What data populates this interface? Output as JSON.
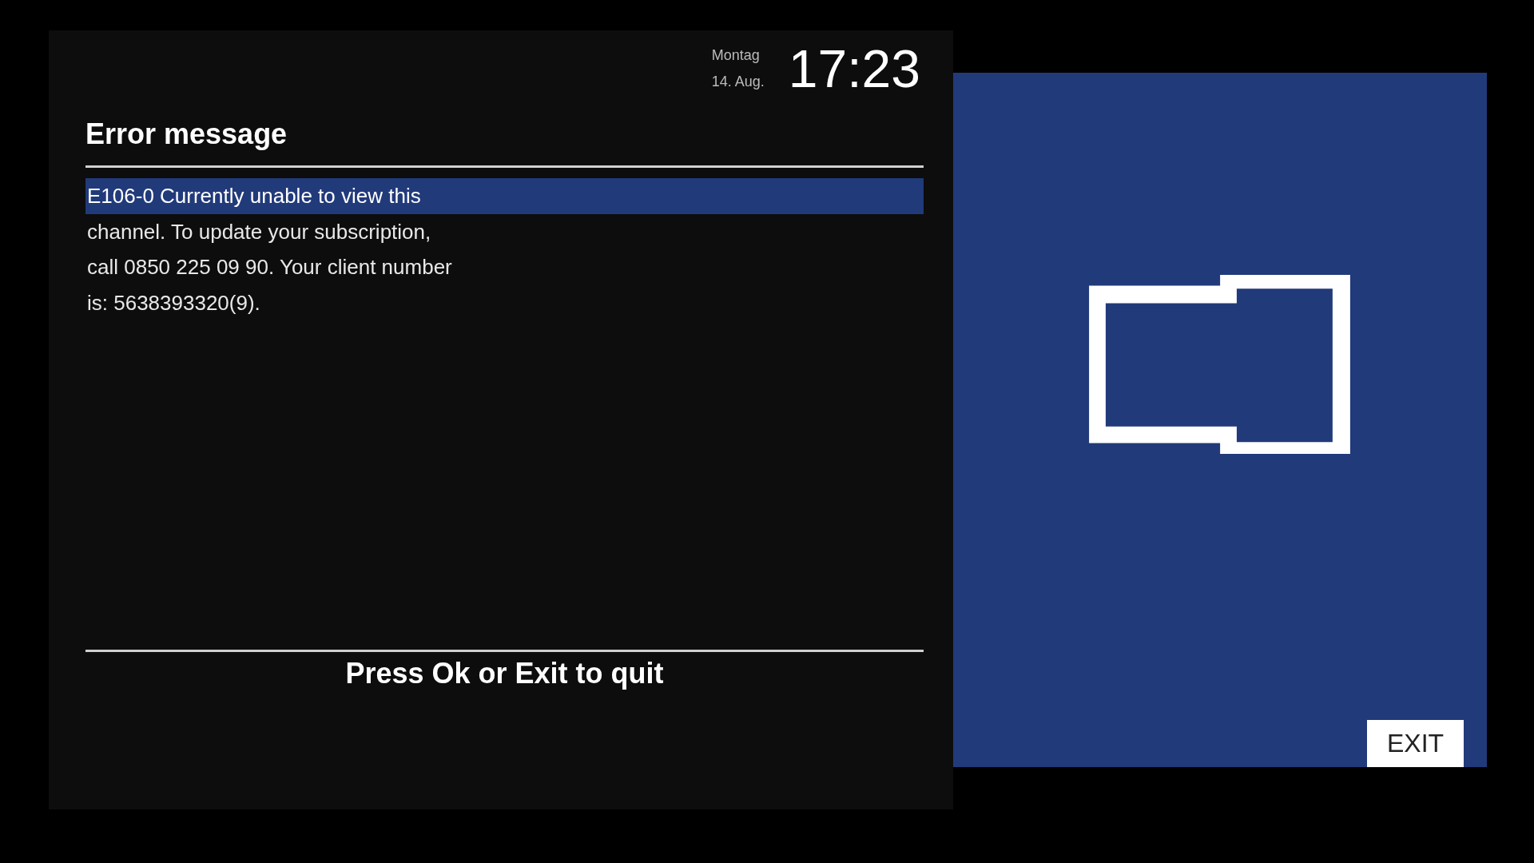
{
  "clock": {
    "weekday": "Montag",
    "date": "14. Aug.",
    "time": "17:23"
  },
  "dialog": {
    "title": "Error message",
    "message_lines": [
      {
        "text": "E106-0 Currently unable to view this",
        "selected": true
      },
      {
        "text": "channel. To update your subscription,",
        "selected": false
      },
      {
        "text": "call 0850 225 09 90. Your client number",
        "selected": false
      },
      {
        "text": "is: 5638393320(9).",
        "selected": false
      }
    ],
    "footer": "Press Ok or Exit to quit"
  },
  "preview": {
    "exit_button": "EXIT"
  }
}
